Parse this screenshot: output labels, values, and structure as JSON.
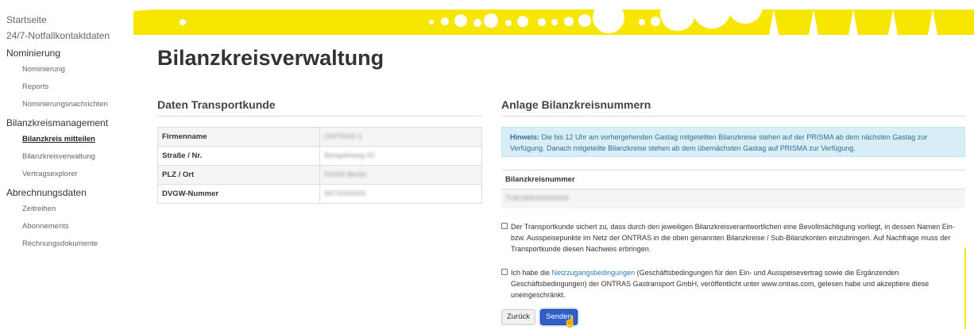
{
  "sidebar": {
    "items": [
      {
        "label": "Startseite",
        "level": "top"
      },
      {
        "label": "24/7-Notfallkontaktdaten",
        "level": "top"
      },
      {
        "label": "Nominierung",
        "level": "heading"
      },
      {
        "label": "Nominierung",
        "level": "sub"
      },
      {
        "label": "Reports",
        "level": "sub"
      },
      {
        "label": "Nominierungsnachrichten",
        "level": "sub"
      },
      {
        "label": "Bilanzkreismanagement",
        "level": "heading"
      },
      {
        "label": "Bilanzkreis mitteilen",
        "level": "sub",
        "active": true
      },
      {
        "label": "Bilanzkreisverwaltung",
        "level": "sub"
      },
      {
        "label": "Vertragsexplorer",
        "level": "sub"
      },
      {
        "label": "Abrechnungsdaten",
        "level": "heading"
      },
      {
        "label": "Zeitreihen",
        "level": "sub"
      },
      {
        "label": "Abonnements",
        "level": "sub"
      },
      {
        "label": "Rechnungsdokumente",
        "level": "sub"
      }
    ]
  },
  "page": {
    "title": "Bilanzkreisverwaltung"
  },
  "transport": {
    "title": "Daten Transportkunde",
    "rows": [
      {
        "key": "Firmenname",
        "value": "ONTRAS-1"
      },
      {
        "key": "Straße / Nr.",
        "value": "Beispielweg 00"
      },
      {
        "key": "PLZ / Ort",
        "value": "00000 Berlin"
      },
      {
        "key": "DVGW-Nummer",
        "value": "9870000000"
      }
    ]
  },
  "anlage": {
    "title": "Anlage Bilanzkreisnummern",
    "hint_label": "Hinweis:",
    "hint_text": " Die bis 12 Uhr am vorhergehenden Gastag mitgeteilten Bilanzkreise stehen auf der PRISMA ab dem nächsten Gastag zur Verfügung. Danach mitgeteilte Bilanzkreise stehen ab dem übernächsten Gastag auf PRISMA zur Verfügung.",
    "table_header": "Bilanzkreisnummer",
    "table_value": "THE0BR40000000"
  },
  "checks": {
    "first": "Der Transportkunde sichert zu, dass durch den jeweiligen Bilanzkreisverantwortlichen eine Bevollmächtigung vorliegt, in dessen Namen Ein-bzw. Ausspeisepunkte im Netz der ONTRAS in die oben genannten Bilanzkreise / Sub-Bilanzkonten einzubringen. Auf Nachfrage muss der Transportkunde diesen Nachweis erbringen.",
    "second_pre": "Ich habe die ",
    "second_link": "Netzzugangsbedingungen",
    "second_post": " (Geschäftsbedingungen für den Ein- und Ausspeisevertrag sowie die Ergänzenden Geschäftsbedingungen) der ONTRAS Gastransport GmbH, veröffentlicht unter www.ontras.com, gelesen habe und akzeptiere diese uneingeschränkt."
  },
  "buttons": {
    "back": "Zurück",
    "send": "Senden"
  },
  "colors": {
    "brand_yellow": "#f7e600",
    "primary_button": "#2f5ec7",
    "hint_bg": "#d9edf7"
  }
}
